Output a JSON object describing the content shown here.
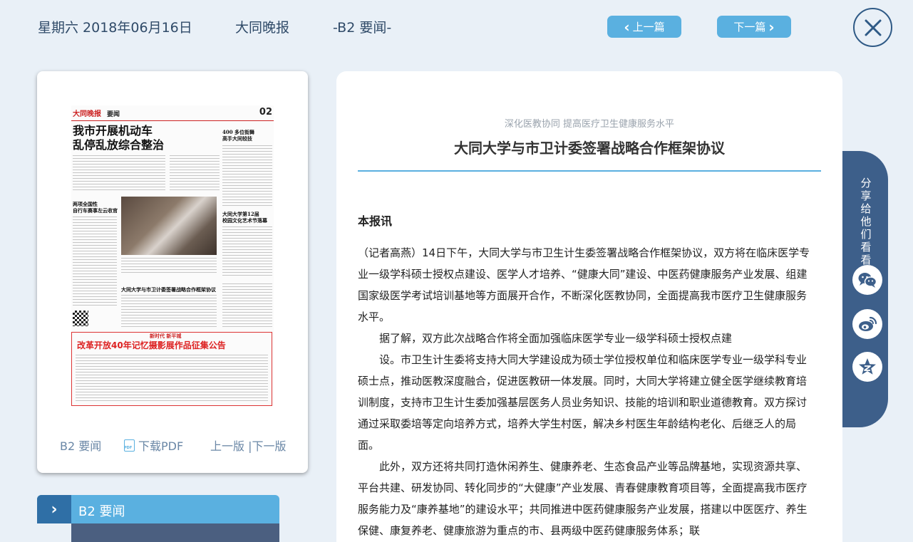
{
  "header": {
    "date": "星期六 2018年06月16日",
    "paper_name": "大同晚报",
    "section": "-B2 要闻-",
    "prev_label": "上一篇",
    "next_label": "下一篇"
  },
  "thumbnail": {
    "masthead_logo": "大同晚报",
    "masthead_section": "要闻",
    "page_number": "02",
    "headline": "我市开展机动车\n乱停乱放综合整治",
    "sub_heads": [
      "400 多位街舞\n高手大同较技",
      "两项全国性\n自行车赛事左云收官",
      "大同大学第12届\n校园文化艺术节落幕",
      "大同大学与市卫计委签署战略合作框架协议"
    ],
    "ad_top": "新时代 新平城",
    "ad_title": "改革开放40年记忆摄影展作品征集公告"
  },
  "thumb_footer": {
    "section": "B2 要闻",
    "pdf_label": "下载PDF",
    "pages": "上一版 |下一版"
  },
  "section_bar": {
    "label": "B2 要闻"
  },
  "article": {
    "subtitle": "深化医教协同 提高医疗卫生健康服务水平",
    "title": "大同大学与市卫计委签署战略合作框架协议",
    "byline": "本报讯",
    "paragraphs": [
      "（记者高燕）14日下午，大同大学与市卫生计生委签署战略合作框架协议，双方将在临床医学专业一级学科硕士授权点建设、医学人才培养、“健康大同”建设、中医药健康服务产业发展、组建国家级医学考试培训基地等方面展开合作，不断深化医教协同，全面提高我市医疗卫生健康服务水平。",
      "据了解，双方此次战略合作将全面加强临床医学专业一级学科硕士授权点建",
      "设。市卫生计生委将支持大同大学建设成为硕士学位授权单位和临床医学专业一级学科专业硕士点，推动医教深度融合，促进医教研一体发展。同时，大同大学将建立健全医学继续教育培训制度，支持市卫生计生委加强基层医务人员业务知识、技能的培训和职业道德教育。双方探讨通过采取委培等定向培养方式，培养大学生村医，解决乡村医生年龄结构老化、后继乏人的局面。",
      "此外，双方还将共同打造休闲养生、健康养老、生态食品产业等品牌基地，实现资源共享、平台共建、研发协同、转化同步的“大健康”产业发展、青春健康教育项目等，全面提高我市医疗服务能力及“康养基地”的建设水平；共同推进中医药健康服务产业发展，搭建以中医医疗、养生保健、康复养老、健康旅游为重点的市、县两级中医药健康服务体系；联"
    ]
  },
  "share": {
    "label": "分\n享\n给\n他\n们\n看\n看"
  },
  "colors": {
    "accent": "#5ab0e0",
    "navy": "#2f5a86",
    "panel": "#3d5f8a",
    "background": "#e9f0f7"
  }
}
